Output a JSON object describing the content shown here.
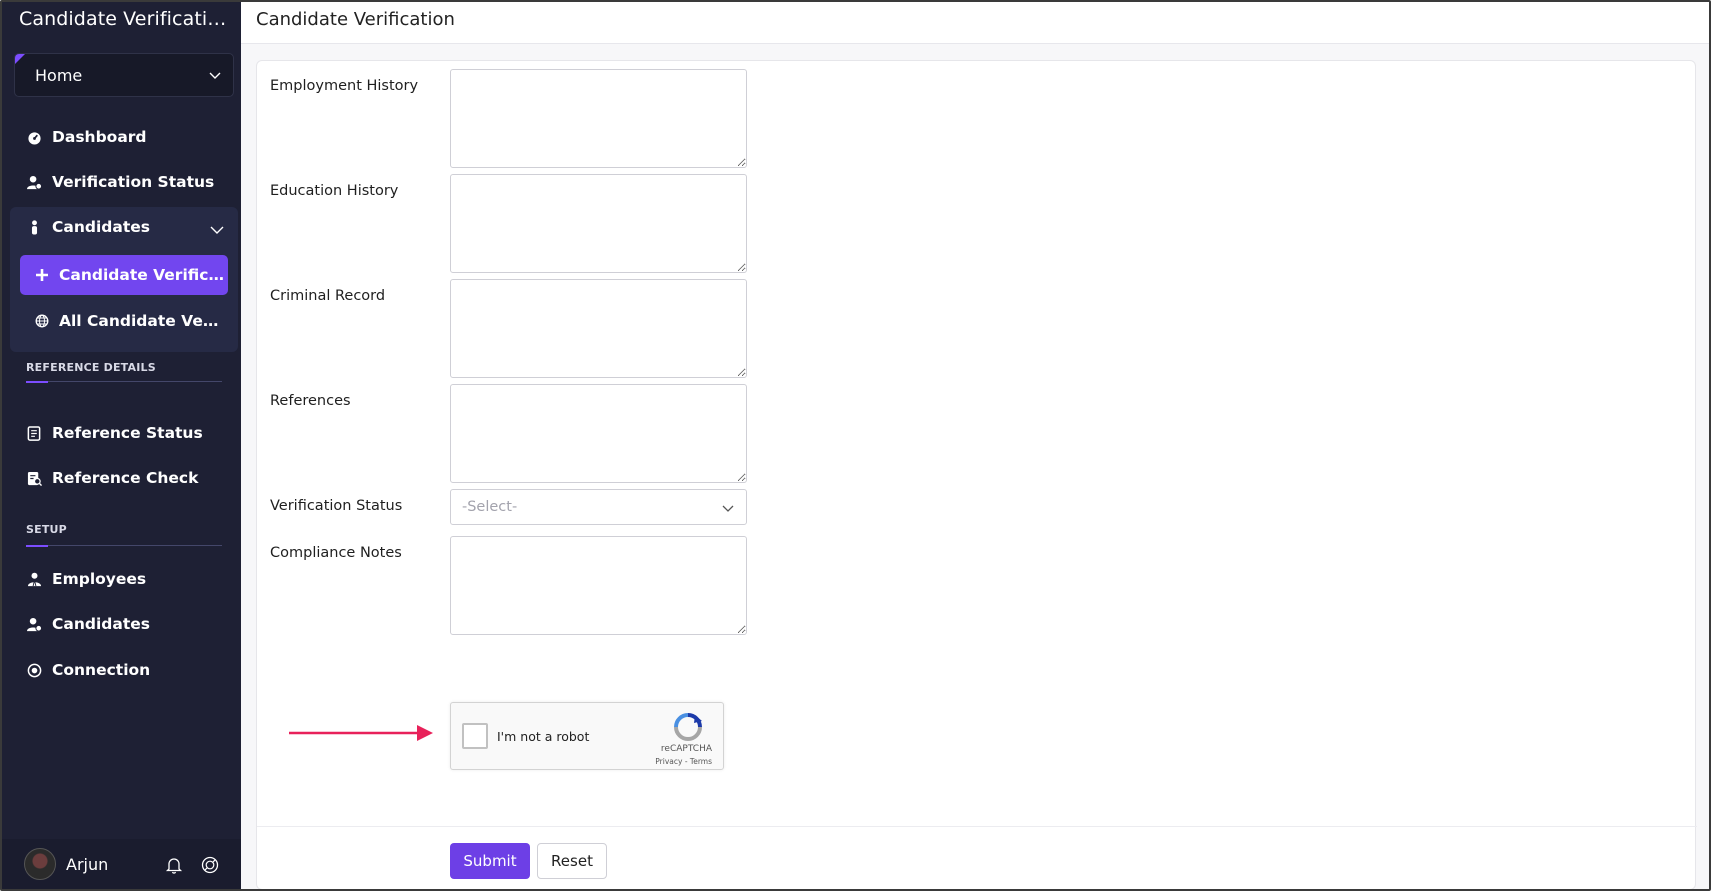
{
  "app": {
    "title": "Candidate Verification"
  },
  "sidebar": {
    "home_select": "Home",
    "nav": [
      {
        "label": "Dashboard",
        "icon": "dashboard-icon"
      },
      {
        "label": "Verification Status",
        "icon": "user-check-icon"
      }
    ],
    "group": {
      "label": "Candidates",
      "icon": "person-icon",
      "children": [
        {
          "label": "Candidate Verification",
          "icon": "plus-icon",
          "active": true
        },
        {
          "label": "All Candidate Verifications",
          "icon": "globe-icon",
          "active": false
        }
      ]
    },
    "sections": [
      {
        "heading": "REFERENCE DETAILS",
        "items": [
          {
            "label": "Reference Status",
            "icon": "document-icon"
          },
          {
            "label": "Reference Check",
            "icon": "document-search-icon"
          }
        ]
      },
      {
        "heading": "SETUP",
        "items": [
          {
            "label": "Employees",
            "icon": "employees-icon"
          },
          {
            "label": "Candidates",
            "icon": "user-gear-icon"
          },
          {
            "label": "Connection",
            "icon": "plug-icon"
          }
        ]
      }
    ],
    "footer": {
      "user_name": "Arjun"
    }
  },
  "page": {
    "title": "Candidate Verification"
  },
  "form": {
    "fields": {
      "employment_history": {
        "label": "Employment History",
        "value": ""
      },
      "education_history": {
        "label": "Education History",
        "value": ""
      },
      "criminal_record": {
        "label": "Criminal Record",
        "value": ""
      },
      "references": {
        "label": "References",
        "value": ""
      },
      "verification_status": {
        "label": "Verification Status",
        "selected": "-Select-"
      },
      "compliance_notes": {
        "label": "Compliance Notes",
        "value": ""
      }
    },
    "captcha": {
      "text": "I'm not a robot",
      "brand": "reCAPTCHA",
      "links": "Privacy - Terms",
      "checked": false
    },
    "buttons": {
      "submit": "Submit",
      "reset": "Reset"
    }
  },
  "colors": {
    "sidebar_bg": "#1e2034",
    "accent": "#7246ef",
    "submit_bg": "#6d3fe6",
    "arrow": "#e8215a"
  }
}
